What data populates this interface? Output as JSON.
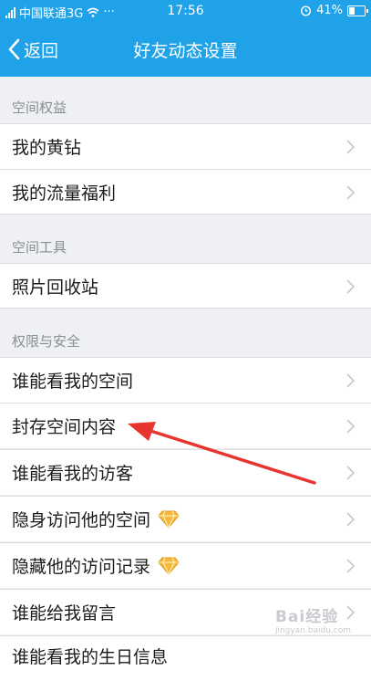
{
  "status": {
    "carrier": "中国联通3G",
    "dots": "···",
    "time": "17:56",
    "battery": "41%"
  },
  "nav": {
    "back_label": "返回",
    "title": "好友动态设置"
  },
  "sections": [
    {
      "title": "空间权益",
      "items": [
        "我的黄钻",
        "我的流量福利"
      ]
    },
    {
      "title": "空间工具",
      "items": [
        "照片回收站"
      ]
    },
    {
      "title": "权限与安全",
      "items": [
        "谁能看我的空间",
        "封存空间内容",
        "谁能看我的访客",
        "隐身访问他的空间",
        "隐藏他的访问记录",
        "谁能给我留言",
        "谁能看我的生日信息"
      ]
    }
  ],
  "colors": {
    "brand": "#1fa2e8",
    "gem": "#f5b83a",
    "annotation_arrow": "#e8342f"
  },
  "watermark": {
    "text": "Bai经验",
    "sub": "jingyan.baidu.com"
  }
}
